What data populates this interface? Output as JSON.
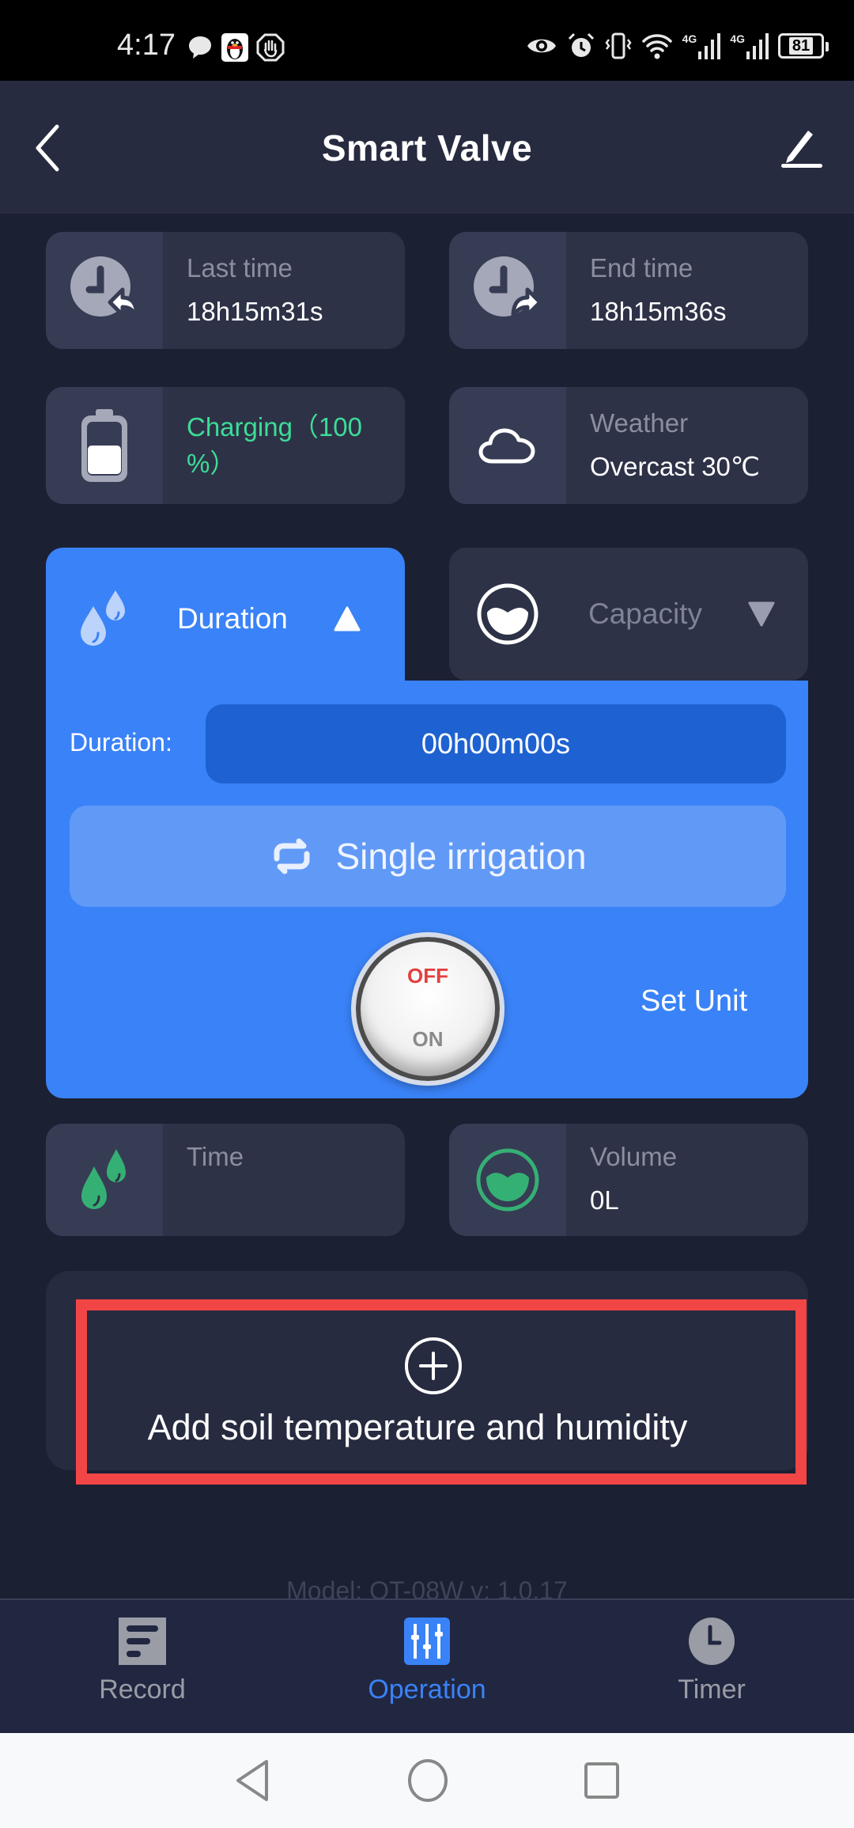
{
  "status_bar": {
    "time": "4:17",
    "left_icons": [
      "chat-bubble-icon",
      "qq-penguin-icon",
      "hand-stop-icon"
    ],
    "right_icons": [
      "eye-icon",
      "alarm-icon",
      "vibrate-icon",
      "wifi-icon",
      "signal-4g-icon",
      "signal-4g-icon"
    ],
    "network_label_1": "4G",
    "network_label_2": "4G",
    "battery": "81"
  },
  "header": {
    "title": "Smart Valve"
  },
  "info_cards": {
    "last_time": {
      "label": "Last time",
      "value": "18h15m31s"
    },
    "end_time": {
      "label": "End time",
      "value": "18h15m36s"
    },
    "battery": {
      "value": "Charging（100%）",
      "line1": "Charging（100",
      "line2": "%）"
    },
    "weather": {
      "label": "Weather",
      "value": "Overcast 30℃"
    }
  },
  "tabs": {
    "duration": {
      "label": "Duration",
      "active": true
    },
    "capacity": {
      "label": "Capacity",
      "active": false
    }
  },
  "duration_panel": {
    "field_label": "Duration:",
    "field_value": "00h00m00s",
    "mode_button": "Single irrigation",
    "switch_off_label": "OFF",
    "switch_on_label": "ON",
    "switch_state": "off",
    "set_unit": "Set Unit"
  },
  "stats": {
    "time": {
      "label": "Time",
      "value": ""
    },
    "volume": {
      "label": "Volume",
      "value": "0L"
    }
  },
  "soil": {
    "add_label": "Add soil temperature and humidity"
  },
  "footer": {
    "model": "Model: QT-08W v: 1.0.17"
  },
  "bottom_nav": {
    "items": [
      {
        "label": "Record",
        "active": false
      },
      {
        "label": "Operation",
        "active": true
      },
      {
        "label": "Timer",
        "active": false
      }
    ]
  },
  "colors": {
    "accent": "#3a82f7",
    "background": "#1b2033",
    "card": "#2e3247",
    "green": "#3ddc97",
    "highlight": "#f24646",
    "switch_off": "#e2403f"
  }
}
